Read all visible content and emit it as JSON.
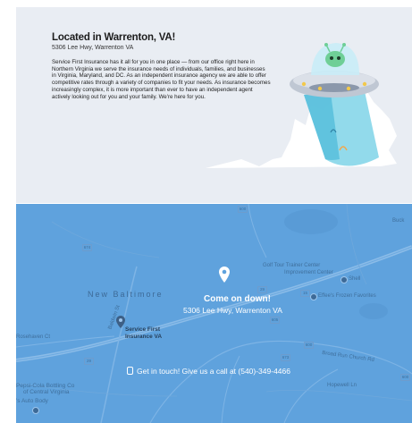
{
  "location": {
    "title": "Located in Warrenton, VA!",
    "address": "5306 Lee Hwy, Warrenton VA",
    "body": "Service First Insurance has it all for you in one place — from our office right here in Northern Virginia we serve the insurance needs of individuals, families, and businesses in Virginia, Maryland, and DC. As an independent insurance agency we are able to offer competitive rates through a variety of companies to fit your needs. As insurance becomes increasingly complex, it is more important than ever to have an independent agent actively looking out for you and your family. We're here for you."
  },
  "map": {
    "cta_title": "Come on down!",
    "cta_address": "5306 Lee Hwy, Warrenton VA",
    "call_text": "Get in touch! Give us a call at (540)-349-4466",
    "town": "New Baltimore",
    "places": {
      "golf": "Golf Tour Trainer Center",
      "improvement": "Improvement Center",
      "shell": "Shell",
      "effees": "Effee's Frozen Favorites",
      "sfi_line1": "Service First",
      "sfi_line2": "Insurance VA",
      "pepsi_line1": "Pepsi-Cola Bottling Co",
      "pepsi_line2": "of Central Virginia",
      "auto_body": "'s Auto Body",
      "buck": "Buck",
      "broad_run": "Broad Run Church Rd",
      "rosehaven": "Rosehaven Ct",
      "baldwin": "Baldwin St",
      "hopewell": "Hopewell Ln"
    },
    "shields": {
      "s1": "674",
      "s2": "600",
      "s3": "29",
      "s4": "15",
      "s5": "605",
      "s6": "600",
      "s7": "673",
      "s8": "29",
      "s9": "600"
    },
    "colors": {
      "map_blue": "#5fa2dd",
      "road": "#8bbce8"
    }
  }
}
